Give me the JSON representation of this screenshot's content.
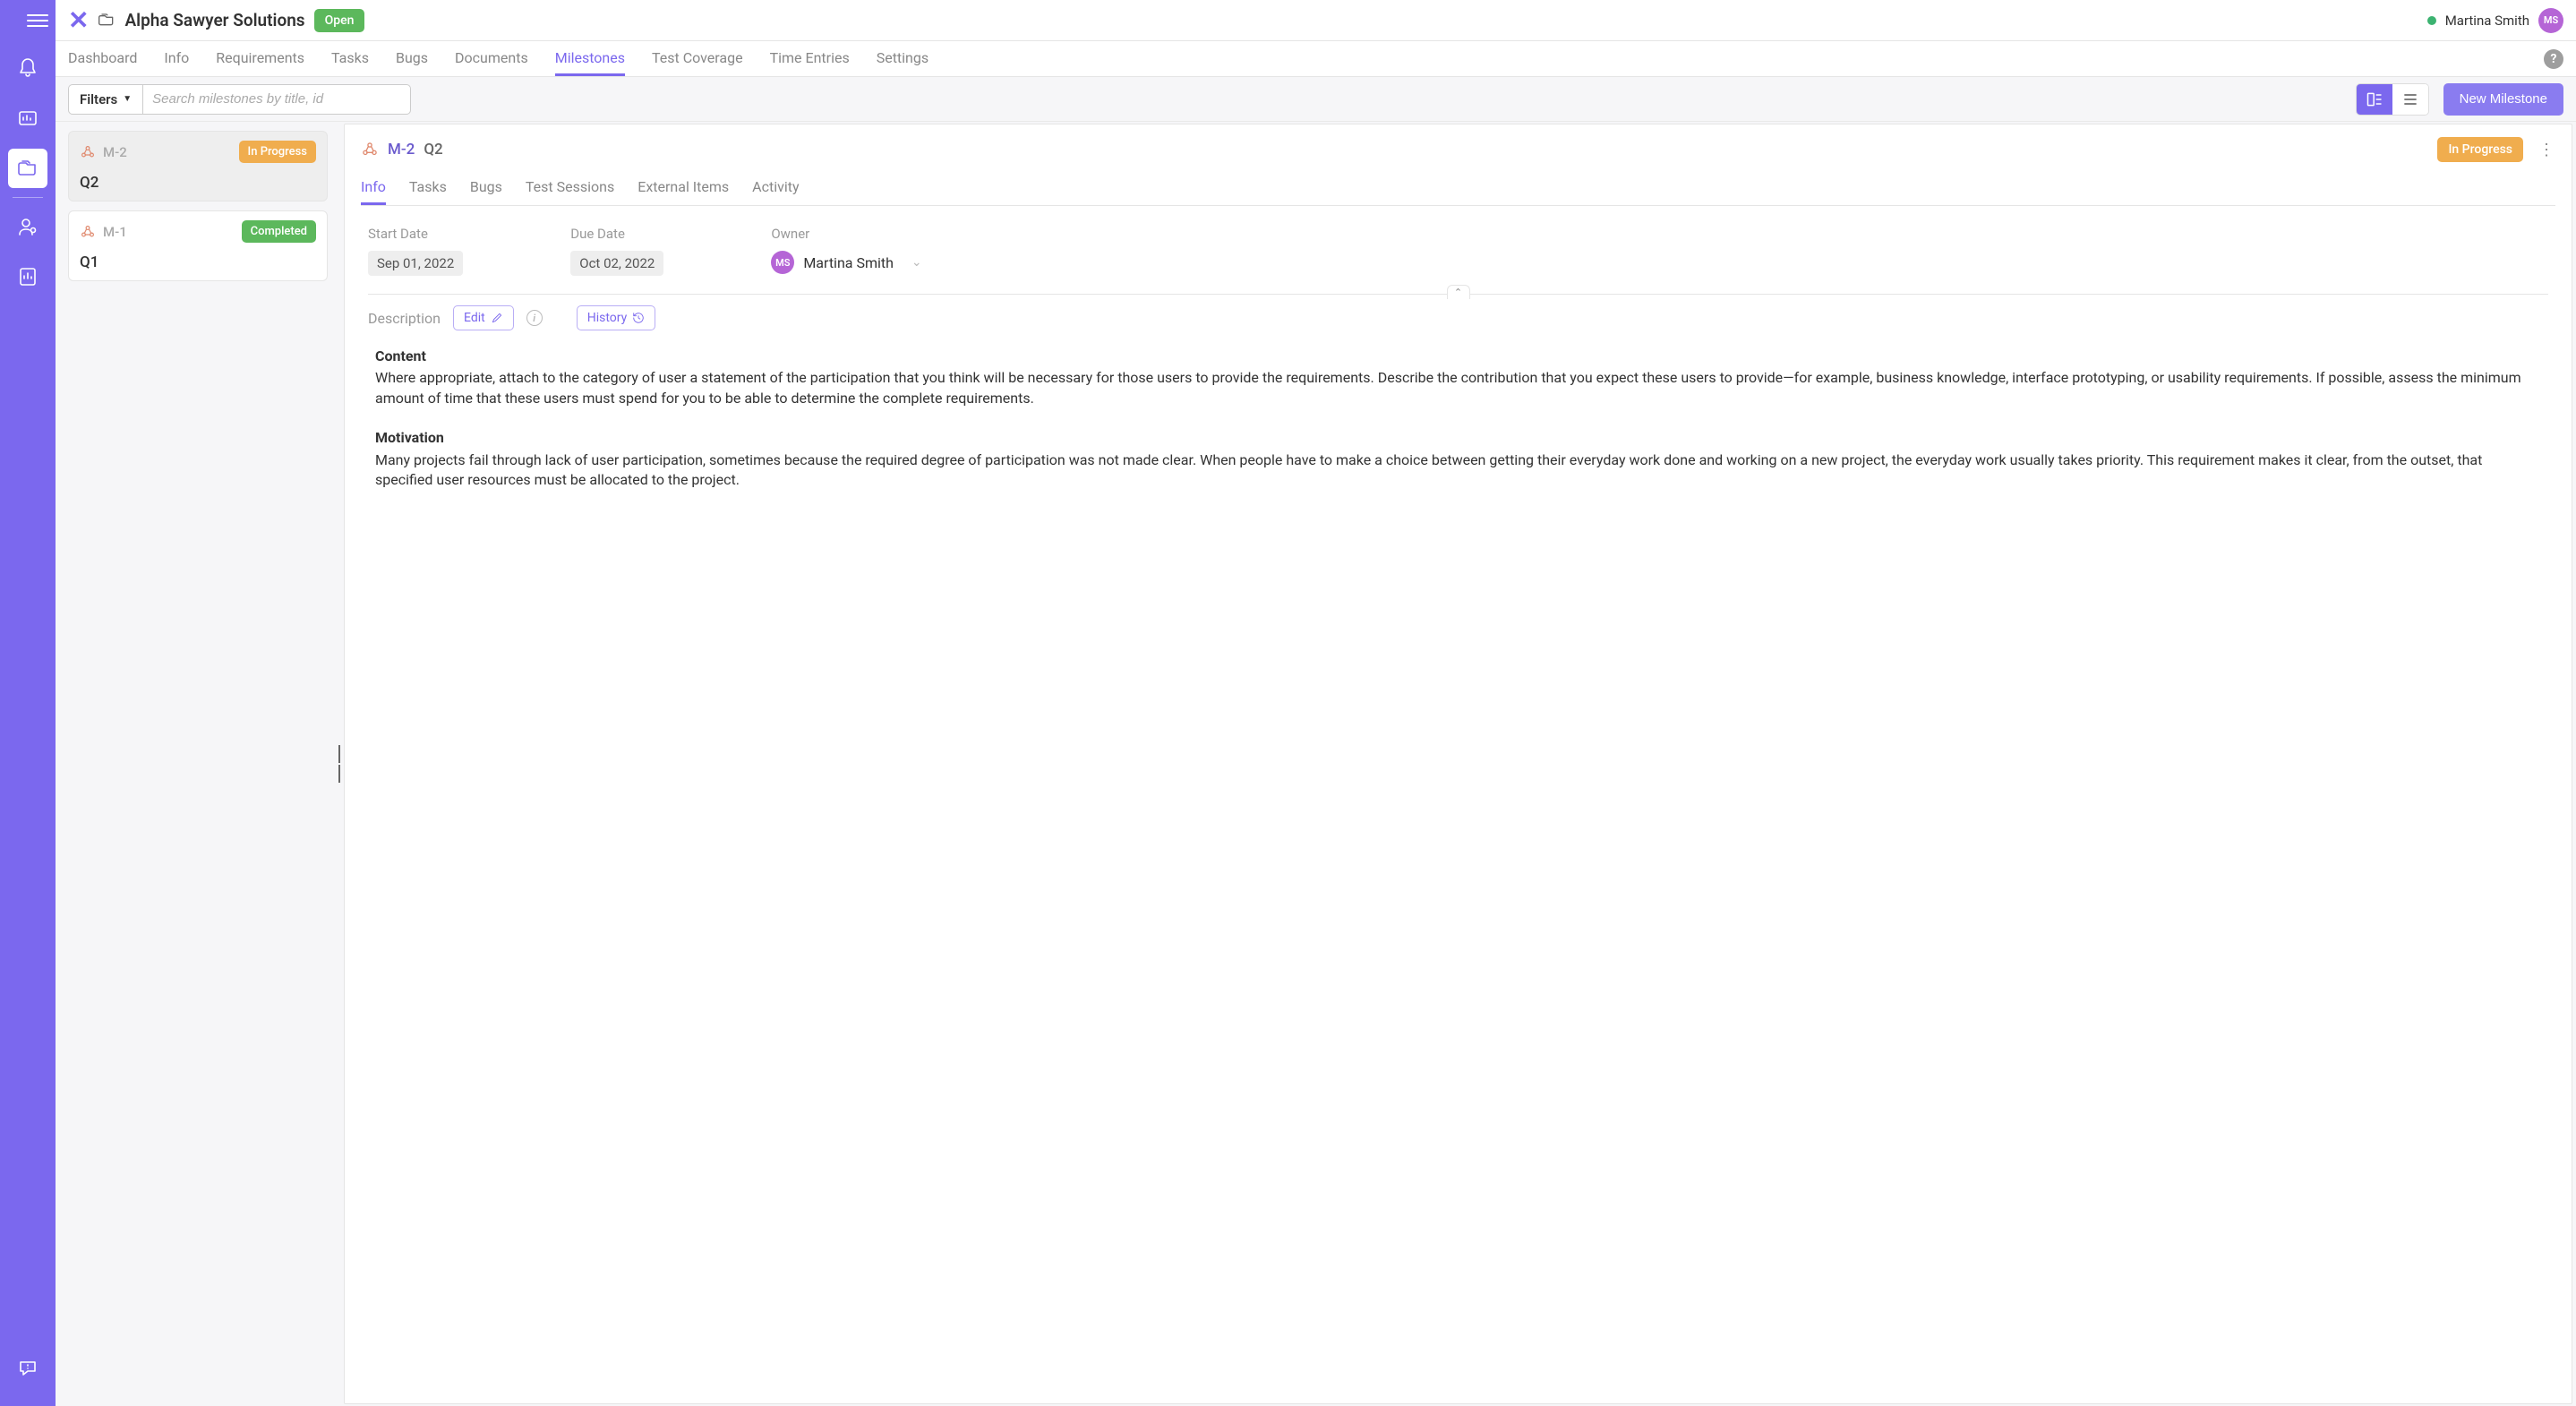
{
  "header": {
    "project_name": "Alpha Sawyer Solutions",
    "status_badge": "Open",
    "user_name": "Martina Smith",
    "user_initials": "MS"
  },
  "nav_tabs": {
    "dashboard": "Dashboard",
    "info": "Info",
    "requirements": "Requirements",
    "tasks": "Tasks",
    "bugs": "Bugs",
    "documents": "Documents",
    "milestones": "Milestones",
    "test_coverage": "Test Coverage",
    "time_entries": "Time Entries",
    "settings": "Settings"
  },
  "toolbar": {
    "filters_label": "Filters",
    "search_placeholder": "Search milestones by title, id",
    "new_button": "New Milestone"
  },
  "milestone_list": {
    "items": [
      {
        "id": "M-2",
        "title": "Q2",
        "status": "In Progress",
        "status_class": "in-progress",
        "selected": true
      },
      {
        "id": "M-1",
        "title": "Q1",
        "status": "Completed",
        "status_class": "completed",
        "selected": false
      }
    ]
  },
  "detail": {
    "id": "M-2",
    "title": "Q2",
    "status": "In Progress",
    "tabs": {
      "info": "Info",
      "tasks": "Tasks",
      "bugs": "Bugs",
      "test_sessions": "Test Sessions",
      "external_items": "External Items",
      "activity": "Activity"
    },
    "meta": {
      "start_date_label": "Start Date",
      "start_date_value": "Sep 01, 2022",
      "due_date_label": "Due Date",
      "due_date_value": "Oct 02, 2022",
      "owner_label": "Owner",
      "owner_name": "Martina Smith",
      "owner_initials": "MS"
    },
    "description": {
      "label": "Description",
      "edit_button": "Edit",
      "history_button": "History",
      "content_heading": "Content",
      "content_body": "Where appropriate, attach to the category of user a statement of the participation that you think will be necessary for those users to provide the requirements. Describe the contribution that you expect these users to provide—for example, business knowledge, interface prototyping, or usability requirements. If possible, assess the minimum amount of time that these users must spend for you to be able to determine the complete requirements.",
      "motivation_heading": "Motivation",
      "motivation_body": "Many projects fail through lack of user participation, sometimes because the required degree of participation was not made clear. When people have to make a choice between getting their everyday work done and working on a new project, the everyday work usually takes priority. This requirement makes it clear, from the outset, that specified user resources must be allocated to the project."
    }
  }
}
